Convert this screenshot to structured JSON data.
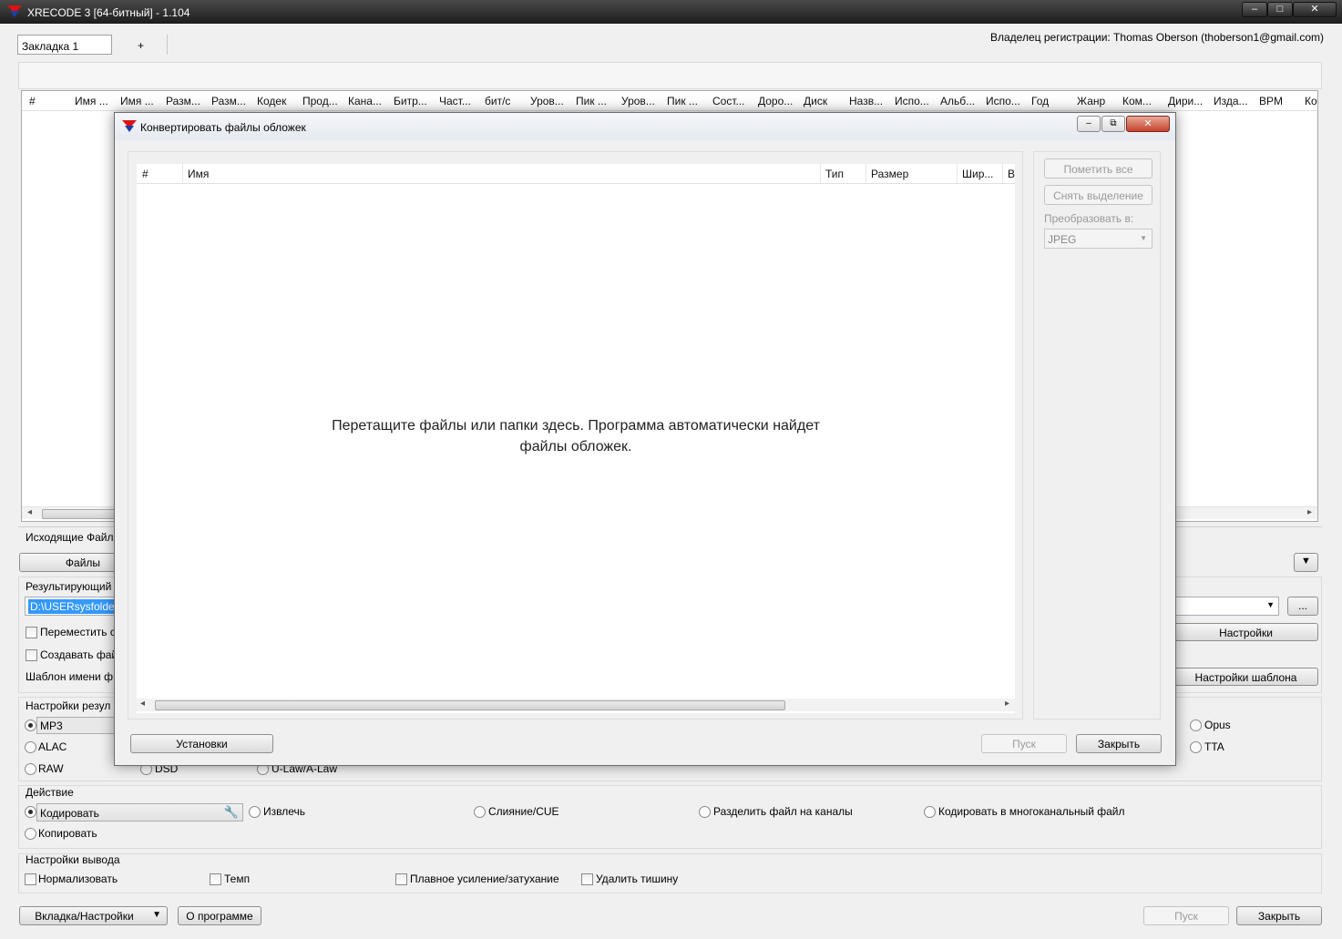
{
  "app": {
    "title": "XRECODE 3 [64-битный] - 1.104",
    "owner": "Владелец регистрации: Thomas Oberson (thoberson1@gmail.com)"
  },
  "tabs": {
    "tab1": "Закладка 1",
    "add": "+"
  },
  "columns": [
    "#",
    "Имя ...",
    "Имя ...",
    "Разм...",
    "Разм...",
    "Кодек",
    "Прод...",
    "Кана...",
    "Битр...",
    "Част...",
    "бит/с",
    "Уров...",
    "Пик ...",
    "Уров...",
    "Пик ...",
    "Сост...",
    "Доро...",
    "Диск",
    "Назв...",
    "Испо...",
    "Альб...",
    "Испо...",
    "Год",
    "Жанр",
    "Ком...",
    "Дири...",
    "Изда...",
    "BPM",
    "Ко"
  ],
  "source": {
    "label": "Исходящие Файлы",
    "files_button": "Файлы"
  },
  "output": {
    "label": "Результирующий",
    "path": "D:\\USERsysfolders",
    "settings_button": "Настройки",
    "browse": "...",
    "move_label": "Переместить с",
    "create_label": "Создавать фай",
    "template_label": "Шаблон имени ф",
    "template_button": "Настройки шаблона"
  },
  "format": {
    "label": "Настройки резул",
    "mp3": "MP3",
    "alac": "ALAC",
    "raw": "RAW",
    "dsd": "DSD",
    "ulaw": "U-Law/A-Law",
    "opus": "Opus",
    "tta": "TTA"
  },
  "action": {
    "label": "Действие",
    "encode": "Кодировать",
    "extract": "Извлечь",
    "merge": "Слияние/CUE",
    "split": "Разделить файл на каналы",
    "multichannel": "Кодировать в многоканальный файл",
    "copy": "Копировать"
  },
  "output_settings": {
    "label": "Настройки вывода",
    "normalize": "Нормализовать",
    "tempo": "Темп",
    "fade": "Плавное усиление/затухание",
    "silence": "Удалить тишину"
  },
  "bottom": {
    "tab_settings": "Вкладка/Настройки",
    "about": "О программе",
    "start": "Пуск",
    "close": "Закрыть"
  },
  "dialog": {
    "title": "Конвертировать файлы обложек",
    "columns": [
      "#",
      "Имя",
      "Тип",
      "Размер",
      "Шир...",
      "В"
    ],
    "drop_text_line1": "Перетащите файлы или папки здесь. Программа автоматически найдет",
    "drop_text_line2": "файлы обложек.",
    "mark_all": "Пометить все",
    "unselect": "Снять выделение",
    "convert_to": "Преобразовать в:",
    "format_value": "JPEG",
    "settings": "Установки",
    "start": "Пуск",
    "close": "Закрыть"
  },
  "icons": [
    "xrecode-logo-icon",
    "minimize-icon",
    "maximize-icon",
    "close-icon",
    "chevron-down-icon",
    "wrench-icon",
    "scroll-left-icon",
    "scroll-right-icon"
  ]
}
